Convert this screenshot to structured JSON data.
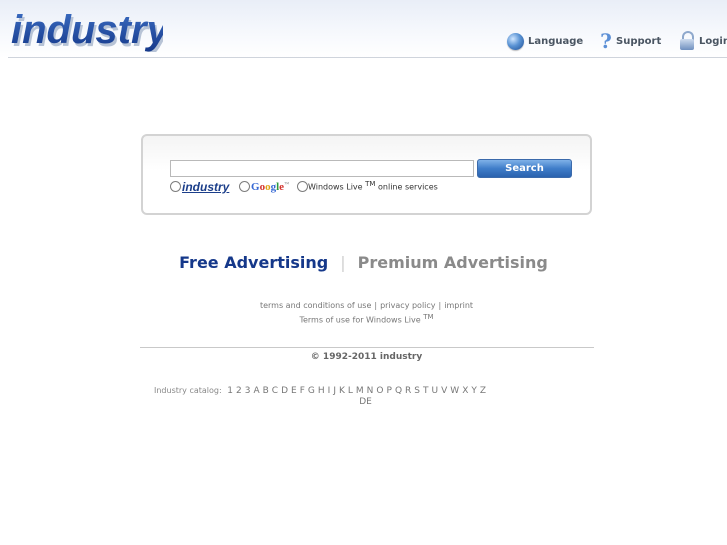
{
  "header": {
    "logo_text": "industry",
    "nav": {
      "language": "Language",
      "support": "Support",
      "login": "Login"
    }
  },
  "search": {
    "input_value": "",
    "button_label": "Search",
    "options": {
      "industry": "industry",
      "google": "Google",
      "google_tm": "™",
      "windows_live": "Windows Live",
      "windows_live_tm": "TM",
      "windows_live_suffix": "online services"
    }
  },
  "advertising": {
    "free": "Free Advertising",
    "separator": "|",
    "premium": "Premium Advertising"
  },
  "footer": {
    "terms": "terms and conditions of use",
    "privacy": "privacy policy",
    "imprint": "imprint",
    "windows_live_terms": "Terms of use for Windows Live",
    "windows_live_tm": "TM",
    "copyright": "© 1992-2011 industry",
    "catalog_label": "Industry catalog:",
    "catalog_letters": [
      "1",
      "2",
      "3",
      "A",
      "B",
      "C",
      "D",
      "E",
      "F",
      "G",
      "H",
      "I",
      "J",
      "K",
      "L",
      "M",
      "N",
      "O",
      "P",
      "Q",
      "R",
      "S",
      "T",
      "U",
      "V",
      "W",
      "X",
      "Y",
      "Z"
    ],
    "language_code": "DE"
  },
  "colors": {
    "brand_blue": "#15388a",
    "button_blue": "#3f7dc9",
    "muted_gray": "#8a8a8a"
  }
}
